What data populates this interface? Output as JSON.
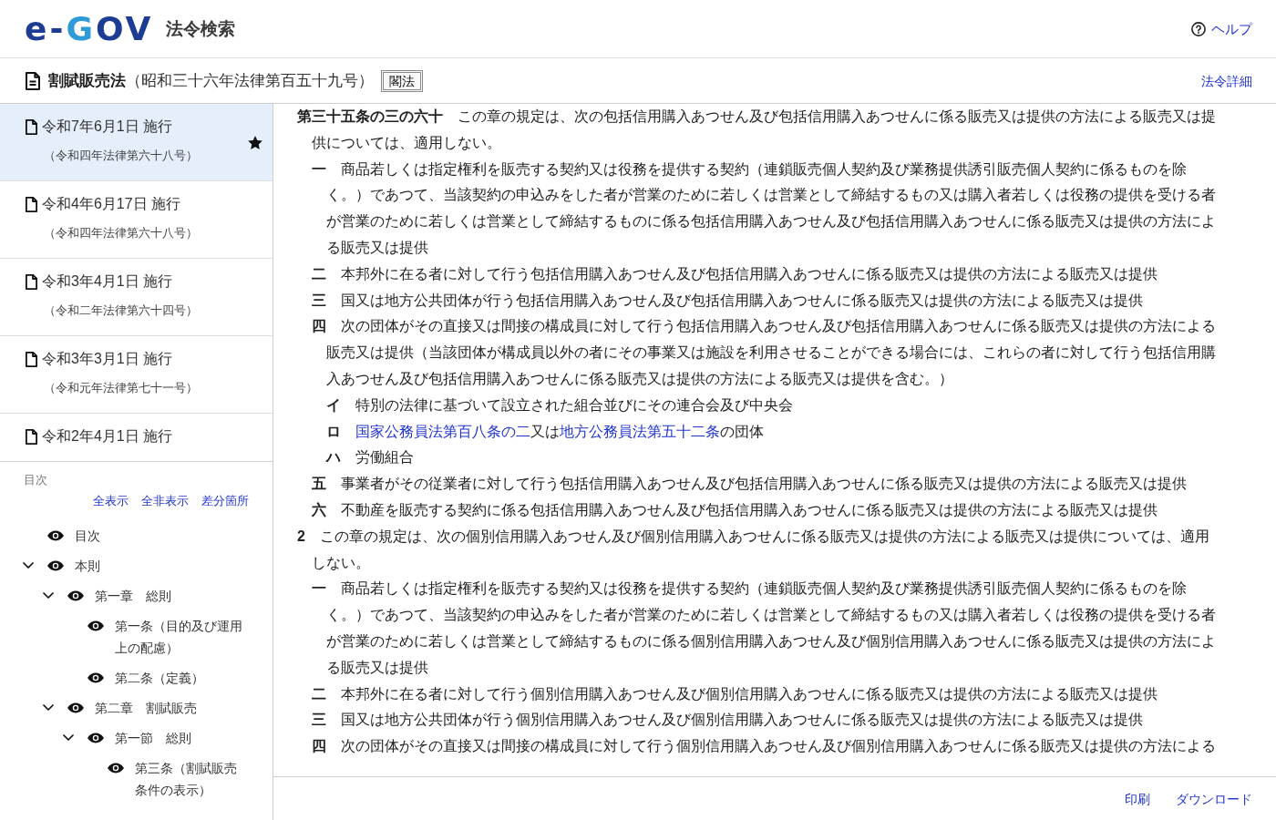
{
  "header": {
    "logo": "e-GOV",
    "service_name": "法令検索",
    "help_link": "ヘルプ"
  },
  "law_bar": {
    "title": "割賦販売法",
    "number": "（昭和三十六年法律第百五十九号）",
    "tag": "閣法",
    "detail_link": "法令詳細"
  },
  "revisions": [
    {
      "date": "令和7年6月1日 施行",
      "law": "（令和四年法律第六十八号）",
      "selected": true,
      "current": true
    },
    {
      "date": "令和4年6月17日 施行",
      "law": "（令和四年法律第六十八号）",
      "selected": false,
      "current": false
    },
    {
      "date": "令和3年4月1日 施行",
      "law": "（令和二年法律第六十四号）",
      "selected": false,
      "current": false
    },
    {
      "date": "令和3年3月1日 施行",
      "law": "（令和元年法律第七十一号）",
      "selected": false,
      "current": false
    },
    {
      "date": "令和2年4月1日 施行",
      "selected": false,
      "current": false
    }
  ],
  "toc": {
    "heading": "目次",
    "actions": [
      "全表示",
      "全非表示",
      "差分箇所"
    ],
    "items": [
      {
        "label": "目次"
      },
      {
        "label": "本則",
        "expanded": true,
        "children": [
          {
            "label": "第一章　総則",
            "expanded": true,
            "children": [
              {
                "label": "第一条（目的及び運用上の配慮）"
              },
              {
                "label": "第二条（定義）"
              }
            ]
          },
          {
            "label": "第二章　割賦販売",
            "expanded": true,
            "children": [
              {
                "label": "第一節　総則",
                "expanded": true,
                "children": [
                  {
                    "label": "第三条（割賦販売条件の表示）"
                  }
                ]
              }
            ]
          }
        ]
      }
    ]
  },
  "article": {
    "text": "**第三十五条の三の六十**　この章の規定は、次の包括信用購入あつせん及び包括信用購入あつせんに係る販売又は提供の方法による販売又は提供については、適用しない。",
    "items": [
      {
        "number": "一",
        "text": "商品若しくは指定権利を販売する契約又は役務を提供する契約（連鎖販売個人契約及び業務提供誘引販売個人契約に係るものを除く。）であつて、当該契約の申込みをした者が営業のために若しくは営業として締結するもの又は購入者若しくは役務の提供を受ける者が営業のために若しくは営業として締結するものに係る包括信用購入あつせん及び包括信用購入あつせんに係る販売又は提供の方法による販売又は提供"
      },
      {
        "number": "二",
        "text": "本邦外に在る者に対して行う包括信用購入あつせん及び包括信用購入あつせんに係る販売又は提供の方法による販売又は提供"
      },
      {
        "number": "三",
        "text": "国又は地方公共団体が行う包括信用購入あつせん及び包括信用購入あつせんに係る販売又は提供の方法による販売又は提供"
      },
      {
        "number": "四",
        "text": "次の団体がその直接又は間接の構成員に対して行う包括信用購入あつせん及び包括信用購入あつせんに係る販売又は提供の方法による販売又は提供（当該団体が構成員以外の者にその事業又は施設を利用させることができる場合には、これらの者に対して行う包括信用購入あつせん及び包括信用購入あつせんに係る販売又は提供の方法による販売又は提供を含む。）",
        "subitems": [
          {
            "number": "イ",
            "parts": [
              {
                "kind": "text",
                "text": "特別の法律に基づいて設立された組合並びにその連合会及び中央会"
              }
            ]
          },
          {
            "number": "ロ",
            "parts": [
              {
                "kind": "link",
                "text": "国家公務員法第百八条の二"
              },
              {
                "kind": "text",
                "text": "又は"
              },
              {
                "kind": "link",
                "text": "地方公務員法第五十二条"
              },
              {
                "kind": "text",
                "text": "の団体"
              }
            ]
          },
          {
            "number": "ハ",
            "parts": [
              {
                "kind": "text",
                "text": "労働組合"
              }
            ]
          }
        ]
      },
      {
        "number": "五",
        "text": "事業者がその従業者に対して行う包括信用購入あつせん及び包括信用購入あつせんに係る販売又は提供の方法による販売又は提供"
      },
      {
        "number": "六",
        "text": "不動産を販売する契約に係る包括信用購入あつせん及び包括信用購入あつせんに係る販売又は提供の方法による販売又は提供"
      }
    ],
    "paragraphs": [
      {
        "number": "2",
        "text": "この章の規定は、次の個別信用購入あつせん及び個別信用購入あつせんに係る販売又は提供の方法による販売又は提供については、適用しない。",
        "items": [
          {
            "number": "一",
            "text": "商品若しくは指定権利を販売する契約又は役務を提供する契約（連鎖販売個人契約及び業務提供誘引販売個人契約に係るものを除く。）であつて、当該契約の申込みをした者が営業のために若しくは営業として締結するもの又は購入者若しくは役務の提供を受ける者が営業のために若しくは営業として締結するものに係る個別信用購入あつせん及び個別信用購入あつせんに係る販売又は提供の方法による販売又は提供"
          },
          {
            "number": "二",
            "text": "本邦外に在る者に対して行う個別信用購入あつせん及び個別信用購入あつせんに係る販売又は提供の方法による販売又は提供"
          },
          {
            "number": "三",
            "text": "国又は地方公共団体が行う個別信用購入あつせん及び個別信用購入あつせんに係る販売又は提供の方法による販売又は提供"
          },
          {
            "number": "四",
            "text": "次の団体がその直接又は間接の構成員に対して行う個別信用購入あつせん及び個別信用購入あつせんに係る販売又は提供の方法による"
          }
        ]
      }
    ]
  },
  "footer": {
    "actions": [
      "印刷",
      "ダウンロード"
    ]
  }
}
